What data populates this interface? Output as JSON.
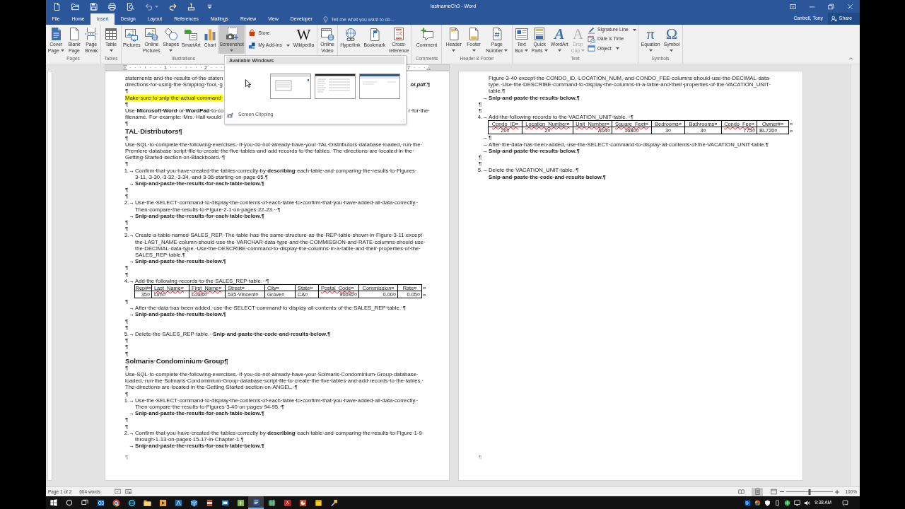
{
  "title_bar": {
    "quick_access": [
      {
        "disabled": false
      },
      {
        "disabled": false
      },
      {
        "disabled": false
      },
      {
        "disabled": false
      },
      {
        "disabled": false
      },
      {
        "disabled": true
      },
      {
        "disabled": false
      },
      {
        "disabled": false
      },
      {
        "disabled": false
      }
    ],
    "title": "lastnameCh3 - Word"
  },
  "tabs": [
    {
      "label": "File",
      "selected": false
    },
    {
      "label": "Home",
      "selected": false
    },
    {
      "label": "Insert",
      "selected": true
    },
    {
      "label": "Design",
      "selected": false
    },
    {
      "label": "Layout",
      "selected": false
    },
    {
      "label": "References",
      "selected": false
    },
    {
      "label": "Mailings",
      "selected": false
    },
    {
      "label": "Review",
      "selected": false
    },
    {
      "label": "View",
      "selected": false
    },
    {
      "label": "Developer",
      "selected": false
    }
  ],
  "tell_me": {
    "placeholder": "Tell me what you want to do..."
  },
  "account": {
    "user": "Cantrell, Tony",
    "share": "Share"
  },
  "ribbon": {
    "groups": [
      {
        "label": "Pages",
        "items": [
          {
            "kind": "large",
            "lines": [
              "Cover",
              "Page"
            ],
            "dropdown": true,
            "disabled": false,
            "expanded": false
          },
          {
            "kind": "large",
            "lines": [
              "Blank",
              "Page"
            ],
            "disabled": false,
            "expanded": false
          },
          {
            "kind": "large",
            "lines": [
              "Page",
              "Break"
            ],
            "disabled": false,
            "expanded": false
          }
        ]
      },
      {
        "label": "Tables",
        "items": [
          {
            "kind": "large",
            "lines": [
              "Table"
            ],
            "dropdown": true,
            "disabled": false,
            "expanded": false
          }
        ]
      },
      {
        "label": "Illustrations",
        "items": [
          {
            "kind": "large",
            "lines": [
              "Pictures"
            ],
            "disabled": false,
            "expanded": false
          },
          {
            "kind": "large",
            "lines": [
              "Online",
              "Pictures"
            ],
            "disabled": false,
            "expanded": false
          },
          {
            "kind": "large",
            "lines": [
              "Shapes"
            ],
            "dropdown": true,
            "disabled": false,
            "expanded": false
          },
          {
            "kind": "large",
            "lines": [
              "SmartArt"
            ],
            "disabled": false,
            "expanded": false
          },
          {
            "kind": "large",
            "lines": [
              "Chart"
            ],
            "disabled": false,
            "expanded": false
          },
          {
            "kind": "large",
            "lines": [
              "Screenshot"
            ],
            "dropdown": true,
            "disabled": false,
            "expanded": true
          }
        ]
      },
      {
        "items": [
          {
            "kind": "stack",
            "items": [
              {
                "label": "Store",
                "disabled": false,
                "expanded": false
              },
              {
                "label": "My Add-ins",
                "dropdown": true,
                "disabled": false,
                "expanded": false
              }
            ]
          },
          {
            "kind": "large",
            "glyph": "W",
            "lines": [
              "Wikipedia"
            ],
            "disabled": false,
            "expanded": false
          }
        ]
      },
      {
        "items": [
          {
            "kind": "large",
            "lines": [
              "Online",
              "Video"
            ],
            "disabled": false,
            "expanded": false
          }
        ]
      },
      {
        "items": [
          {
            "kind": "large",
            "lines": [
              "Hyperlink"
            ],
            "disabled": false,
            "expanded": false
          },
          {
            "kind": "large",
            "lines": [
              "Bookmark"
            ],
            "disabled": false,
            "expanded": false
          },
          {
            "kind": "large",
            "lines": [
              "Cross-",
              "reference"
            ],
            "disabled": false,
            "expanded": false
          }
        ]
      },
      {
        "label": "Comments",
        "items": [
          {
            "kind": "large",
            "lines": [
              "Comment"
            ],
            "disabled": false,
            "expanded": false
          }
        ]
      },
      {
        "label": "Header & Footer",
        "items": [
          {
            "kind": "large",
            "lines": [
              "Header"
            ],
            "dropdown": true,
            "disabled": false,
            "expanded": false
          },
          {
            "kind": "large",
            "lines": [
              "Footer"
            ],
            "dropdown": true,
            "disabled": false,
            "expanded": false
          },
          {
            "kind": "large",
            "lines": [
              "Page",
              "Number"
            ],
            "dropdown": true,
            "disabled": false,
            "expanded": false
          }
        ]
      },
      {
        "label": "Text",
        "items": [
          {
            "kind": "large",
            "lines": [
              "Text",
              "Box"
            ],
            "dropdown": true,
            "disabled": false,
            "expanded": false
          },
          {
            "kind": "large",
            "lines": [
              "Quick",
              "Parts"
            ],
            "dropdown": true,
            "disabled": false,
            "expanded": false
          },
          {
            "kind": "large",
            "glyph": "A",
            "lines": [
              "WordArt"
            ],
            "dropdown": true,
            "disabled": false,
            "expanded": false
          },
          {
            "kind": "large",
            "glyph": "A",
            "lines": [
              "Drop",
              "Cap"
            ],
            "dropdown": true,
            "disabled": true,
            "expanded": false
          },
          {
            "kind": "stack",
            "items": [
              {
                "label": "Signature Line",
                "dropdown": true,
                "disabled": false,
                "expanded": false
              },
              {
                "label": "Date & Time",
                "disabled": false,
                "expanded": false
              },
              {
                "label": "Object",
                "dropdown": true,
                "disabled": false,
                "expanded": false
              }
            ]
          }
        ]
      },
      {
        "label": "Symbols",
        "items": [
          {
            "kind": "large",
            "glyph": "π",
            "lines": [
              "Equation"
            ],
            "dropdown": true,
            "disabled": false,
            "expanded": false
          },
          {
            "kind": "large",
            "glyph": "Ω",
            "lines": [
              "Symbol"
            ],
            "dropdown": true,
            "disabled": false,
            "expanded": false
          }
        ]
      }
    ]
  },
  "screenshot_menu": {
    "heading": "Available Windows",
    "clipping": "Screen Clipping"
  },
  "document": {
    "ruler": {
      "numbers": [
        "1",
        "2",
        "7"
      ]
    },
    "pages": [
      {
        "blocks": [
          {
            "kind": "split",
            "left": "statements·and·the·results·of·the·staten"
          },
          {
            "kind": "split",
            "left": "directions·for·using·the·Snipping·Tool,·g",
            "right": "ol.pdf.¶",
            "emphasis": true
          },
          {
            "kind": "mark",
            "text": "¶"
          },
          {
            "kind": "para",
            "lines": [
              "Make·sure·to·snip·the·actual·command·"
            ],
            "highlighted": true
          },
          {
            "kind": "mark",
            "text": "¶"
          },
          {
            "kind": "split",
            "left": "Use·**Microsoft·Word**·or·**WordPad**·to·co",
            "right": "r·for·the·"
          },
          {
            "kind": "split",
            "left": "filename.·For·example:·Mrs.·Hall·would·"
          },
          {
            "kind": "mark",
            "text": "¶"
          },
          {
            "kind": "heading",
            "text": "TAL·Distributors¶"
          },
          {
            "kind": "mark",
            "text": "¶"
          },
          {
            "kind": "para",
            "lines": [
              "Use·SQL·to·complete·the·following·exercises.·If·you·do·not·already·have·your·TAL·Distributors·database·loaded,·run·the·",
              "Premiere·database·script·file·to·create·the·five·tables·and·add·records·to·the·tables.·The·directions·are·located·in·the·",
              "Getting·Started·section·on·Blackboard.·¶"
            ]
          },
          {
            "kind": "mark",
            "text": "¶"
          },
          {
            "kind": "item",
            "lead": "1.→",
            "lines": [
              "Confirm·that·you·have·created·the·tables·correctly·by·**describing**·each·table·and·comparing·the·results·to·Figures·",
              "3-11,·3-30,·3-32,·3-34,·and·3-36·starting·on·page·65.¶"
            ]
          },
          {
            "kind": "item",
            "lead": "→",
            "lines": [
              "Snip·and·paste·the·results·for·each·table·below.¶"
            ],
            "bold": true
          },
          {
            "kind": "mark",
            "text": "¶"
          },
          {
            "kind": "mark",
            "text": "¶"
          },
          {
            "kind": "item",
            "lead": "2.→",
            "lines": [
              "Use·the·SELECT·command·to·display·the·contents·of·each·table·to·confirm·that·you·have·added·all·data·correctly.·",
              "Then·compare·the·results·to·Figure·2-1·on·pages·22-23.··¶"
            ]
          },
          {
            "kind": "item",
            "lead": "→",
            "lines": [
              "Snip·and·paste·the·results·for·each·table·below.¶"
            ],
            "bold": true
          },
          {
            "kind": "mark",
            "text": "¶"
          },
          {
            "kind": "mark",
            "text": "¶"
          },
          {
            "kind": "item",
            "lead": "3.→",
            "lines": [
              "Create·a·table·named·SALES_REP.·The·table·has·the·same·structure·as·the·REP·table·shown·in·Figure·3-11·except·",
              "the·LAST_NAME·column·should·use·the·VARCHAR·data·type·and·the·COMMISSION·and·RATE·columns·should·use·",
              "the·DECIMAL·data·type.·Use·the·DESCRIBE·command·to·display·the·columns·in·a·table·and·their·properties·of·the·",
              "SALES_REP·table.¶"
            ]
          },
          {
            "kind": "item",
            "lead": "→",
            "lines": [
              "Snip·and·paste·the·results·below.¶"
            ],
            "bold": true
          },
          {
            "kind": "mark",
            "text": "¶"
          },
          {
            "kind": "mark",
            "text": "¶"
          },
          {
            "kind": "item",
            "lead": "4.→",
            "lines": [
              "Add·the·following·records·to·the·SALES_REP·table.··¶"
            ]
          },
          {
            "kind": "table",
            "columns": [
              {
                "text": "Rep#¤",
                "misspelled": false
              },
              {
                "text": "Last_Name¤",
                "misspelled": true
              },
              {
                "text": "First_Name¤",
                "misspelled": true
              },
              {
                "text": "Street¤",
                "misspelled": false
              },
              {
                "text": "City¤",
                "misspelled": false
              },
              {
                "text": "State¤",
                "misspelled": false
              },
              {
                "text": "Postal_Code¤",
                "misspelled": true
              },
              {
                "text": "Commission¤",
                "misspelled": false
              },
              {
                "text": "Rate¤",
                "misspelled": false
              }
            ],
            "columns_end": "¤",
            "rows": [
              {
                "cells": [
                  "35¤",
                  "Lim¤",
                  "Louis¤",
                  "535·Vincent¤",
                  "Grove¤",
                  "CA¤",
                  "90092¤",
                  "0.00¤",
                  "0.05¤"
                ],
                "end": "¤"
              }
            ]
          },
          {
            "kind": "mark",
            "text": "¶"
          },
          {
            "kind": "item",
            "lead": "→",
            "lines": [
              "After·the·data·has·been·added,·use·the·SELECT·command·to·display·all·contents·of·the·SALES_REP·table.·¶"
            ]
          },
          {
            "kind": "item",
            "lead": "→",
            "lines": [
              "Snip·and·paste·the·results·below.¶"
            ],
            "bold": true
          },
          {
            "kind": "mark",
            "text": "¶"
          },
          {
            "kind": "mark",
            "text": "¶"
          },
          {
            "kind": "item",
            "lead": "5.→",
            "lines": [
              "Delete·the·SALES_REP·table.··**Snip·and·paste·the·code·and·results·below.¶**"
            ]
          },
          {
            "kind": "mark",
            "text": "¶"
          },
          {
            "kind": "mark",
            "text": "¶"
          },
          {
            "kind": "mark",
            "text": "¶"
          },
          {
            "kind": "heading",
            "text": "Solmaris·Condominium·Group¶"
          },
          {
            "kind": "mark",
            "text": "¶"
          },
          {
            "kind": "para",
            "lines": [
              "Use·SQL·to·complete·the·following·exercises.·If·you·do·not·already·have·your·Solmaris·Condominium·Group·database·",
              "loaded,·run·the·Solmaris·Condominium·Group·database·script·file·to·create·the·five·tables·and·add·records·to·the·tables.·",
              "The·directions·are·located·in·the·Getting·Started·section·on·ANGEL.·¶"
            ]
          },
          {
            "kind": "mark",
            "text": "¶"
          },
          {
            "kind": "item",
            "lead": "1.→",
            "lines": [
              "Use·the·SELECT·command·to·display·the·contents·of·each·table·to·confirm·that·you·have·added·all·data·correctly.·",
              "Then·compare·the·results·to·Figures·3-40·on·pages·94-95.·¶"
            ]
          },
          {
            "kind": "item",
            "lead": "→",
            "lines": [
              "Snip·and·paste·the·results·for·each·table·below.¶"
            ],
            "bold": true
          },
          {
            "kind": "mark",
            "text": "¶"
          },
          {
            "kind": "mark",
            "text": "¶"
          },
          {
            "kind": "item",
            "lead": "2.→",
            "lines": [
              "Confirm·that·you·have·created·the·tables·correctly·by·**describing**·each·table·and·comparing·the·results·to·Figure·1-9·",
              "through·1-13·on·pages·15-17·in·Chapter·1.¶"
            ]
          },
          {
            "kind": "item",
            "lead": "→",
            "lines": [
              "Snip·and·paste·the·results·for·each·table·below.¶"
            ],
            "bold": true
          }
        ],
        "footer": "¶"
      },
      {
        "blocks": [
          {
            "kind": "item",
            "lines": [
              "Figure·3-40·except·the·CONDO_ID,·LOCATION_NUM,·and·CONDO_FEE·columns·should·use·the·DECIMAL·data·",
              "type.·Use·the·DESCRIBE·command·to·display·the·columns·in·a·table·and·their·properties·of·the·VACATION_UNIT·",
              "table.¶"
            ]
          },
          {
            "kind": "item",
            "lead": "→",
            "lines": [
              "Snip·and·paste·the·results·below.¶"
            ],
            "bold": true
          },
          {
            "kind": "mark",
            "text": "¶"
          },
          {
            "kind": "mark",
            "text": "¶"
          },
          {
            "kind": "item",
            "lead": "4.→",
            "lines": [
              "Add·the·following·records·to·the·VACATION_UNIT·table.··¶"
            ]
          },
          {
            "kind": "table",
            "columns": [
              {
                "text": "Condo_ID¤",
                "misspelled": true
              },
              {
                "text": "Location_Number¤",
                "misspelled": true
              },
              {
                "text": "Unit_Number¤",
                "misspelled": true
              },
              {
                "text": "Square_Feet¤",
                "misspelled": true
              },
              {
                "text": "Bedrooms¤",
                "misspelled": false
              },
              {
                "text": "Bathrooms¤",
                "misspelled": false
              },
              {
                "text": "Condo_Fee¤",
                "misspelled": true
              },
              {
                "text": "Owner#¤",
                "misspelled": false
              }
            ],
            "columns_end": "¤",
            "rows": [
              {
                "cells": [
                  "20¤",
                  "2¤",
                  "A04¤",
                  "1680¤",
                  "3¤",
                  "3¤",
                  "775¤",
                  "BL720¤"
                ],
                "end": "¤"
              }
            ]
          },
          {
            "kind": "item",
            "lead": "→",
            "lines": [
              "¶"
            ]
          },
          {
            "kind": "item",
            "lead": "→",
            "lines": [
              "After·the·data·has·been·added,·use·the·SELECT·command·to·display·all·contents·of·the·VACATION_UNIT·table.¶"
            ]
          },
          {
            "kind": "item",
            "lead": "→",
            "lines": [
              "Snip·and·paste·the·results·below.¶"
            ],
            "bold": true
          },
          {
            "kind": "mark",
            "text": "¶"
          },
          {
            "kind": "mark",
            "text": "¶"
          },
          {
            "kind": "item",
            "lead": "5.→",
            "lines": [
              "Delete·the·VACATION_UNIT·table.·¶",
              "**Snip·and·paste·the·code·and·results·below.¶**"
            ]
          }
        ],
        "footer": "¶"
      }
    ]
  },
  "status_bar": {
    "page": "Page 1 of 2",
    "words": "604 words",
    "views": [
      {
        "selected": false
      },
      {
        "selected": true
      },
      {
        "selected": false
      }
    ],
    "zoom": {
      "level": 0.5,
      "reading": "100%"
    }
  },
  "taskbar": {
    "apps": [
      {
        "selected": false
      },
      {
        "selected": false
      },
      {
        "selected": false
      },
      {
        "selected": false
      },
      {
        "selected": false
      },
      {
        "selected": false
      },
      {
        "selected": false
      },
      {
        "selected": false
      },
      {
        "selected": false
      },
      {
        "selected": false
      },
      {
        "selected": true
      },
      {
        "selected": false
      },
      {
        "selected": false
      },
      {
        "selected": false
      },
      {
        "selected": false
      },
      {
        "selected": false
      }
    ],
    "time": "9:38 AM"
  }
}
